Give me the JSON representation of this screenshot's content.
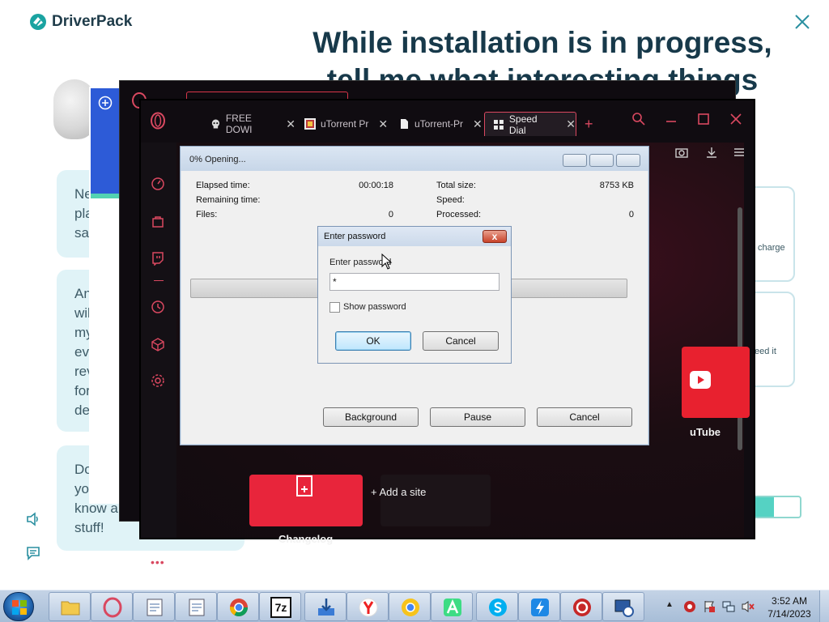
{
  "driverpack": {
    "brand": "DriverPack",
    "headline_line1": "While installation is in progress,",
    "headline_line2": "tell me what interesting things",
    "bubble1": [
      "Ne",
      "pla",
      "sat"
    ],
    "bubble2": [
      "An",
      "wil",
      "my",
      "ev",
      "rev",
      "for",
      "de"
    ],
    "bubble3": [
      "Do",
      "yo",
      "know a",
      "stuff!"
    ],
    "card1_text": "charge",
    "card2_text": "eed it",
    "progress_fraction": 0.45,
    "accent": "#55d2c3"
  },
  "browser": {
    "tabs": [
      {
        "label": "FREE DOWI",
        "icon": "skull-icon"
      },
      {
        "label": "uTorrent Pr",
        "icon": "utorrent-icon"
      },
      {
        "label": "uTorrent-Pr",
        "icon": "document-icon"
      },
      {
        "label": "Speed Dial",
        "icon": "grid-icon"
      }
    ],
    "new_tab": "+",
    "tiles": {
      "youtube_label": "uTube",
      "changelog_label": "Changelog",
      "add_site_label": "+ Add a site"
    },
    "accent": "#d94860"
  },
  "zip_dialog": {
    "title": "0% Opening...",
    "elapsed_label": "Elapsed time:",
    "elapsed_value": "00:00:18",
    "remaining_label": "Remaining time:",
    "remaining_value": "",
    "files_label": "Files:",
    "files_value": "0",
    "total_size_label": "Total size:",
    "total_size_value": "8753 KB",
    "speed_label": "Speed:",
    "speed_value": "",
    "processed_label": "Processed:",
    "processed_value": "0",
    "progress_percent": 0,
    "buttons": {
      "background": "Background",
      "pause": "Pause",
      "cancel": "Cancel"
    }
  },
  "password_dialog": {
    "title": "Enter password",
    "close": "x",
    "field_label": "Enter password",
    "field_value": "*",
    "show_password_label": "Show password",
    "show_password_checked": false,
    "ok": "OK",
    "cancel": "Cancel"
  },
  "taskbar": {
    "apps": [
      "file-explorer-icon",
      "opera-icon",
      "notepad-icon",
      "notepad-icon",
      "chrome-icon",
      "7zip-icon",
      "download-manager-icon",
      "yandex-icon",
      "chrome-canary-icon",
      "android-studio-icon",
      "skype-icon",
      "flash-icon",
      "driver-booster-icon",
      "remote-desktop-icon"
    ],
    "app_7zip_text": "7z",
    "clock_time": "3:52 AM",
    "clock_date": "7/14/2023"
  }
}
